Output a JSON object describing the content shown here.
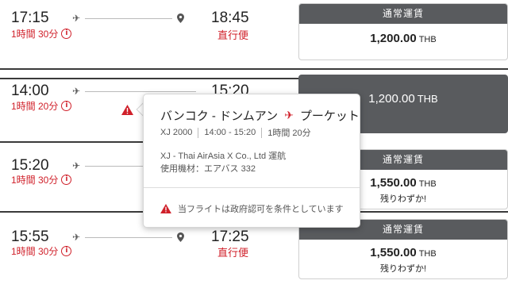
{
  "colors": {
    "accent": "#d0202a",
    "fare_header": "#595b5e",
    "divider": "#3a3a3a"
  },
  "flights": [
    {
      "dep": "17:15",
      "arr": "18:45",
      "duration": "1時間 30分",
      "direct": "直行便",
      "fare_label": "通常運賃",
      "price": "1,200.00",
      "currency": "THB",
      "note": ""
    },
    {
      "dep": "14:00",
      "arr": "15:20",
      "duration": "1時間 20分",
      "direct": "",
      "fare_label": "",
      "price": "1,200.00",
      "currency": "THB",
      "note": ""
    },
    {
      "dep": "15:20",
      "arr": "",
      "duration": "1時間 30分",
      "direct": "",
      "fare_label": "通常運賃",
      "price": "1,550.00",
      "currency": "THB",
      "note": "残りわずか!"
    },
    {
      "dep": "15:55",
      "arr": "17:25",
      "duration": "1時間 30分",
      "direct": "直行便",
      "fare_label": "通常運賃",
      "price": "1,550.00",
      "currency": "THB",
      "note": "残りわずか!"
    }
  ],
  "popup": {
    "from": "バンコク - ドンムアン",
    "to": "プーケット",
    "flight_no": "XJ 2000",
    "times": "14:00 - 15:20",
    "duration": "1時間 20分",
    "operator": "XJ - Thai AirAsia X Co., Ltd 運航",
    "aircraft": "使用機材：エアバス 332",
    "note": "当フライトは政府認可を条件としています"
  },
  "icons": {
    "plane": "airplane-icon",
    "pin": "location-pin-icon",
    "info": "info-icon",
    "warning": "warning-icon"
  }
}
